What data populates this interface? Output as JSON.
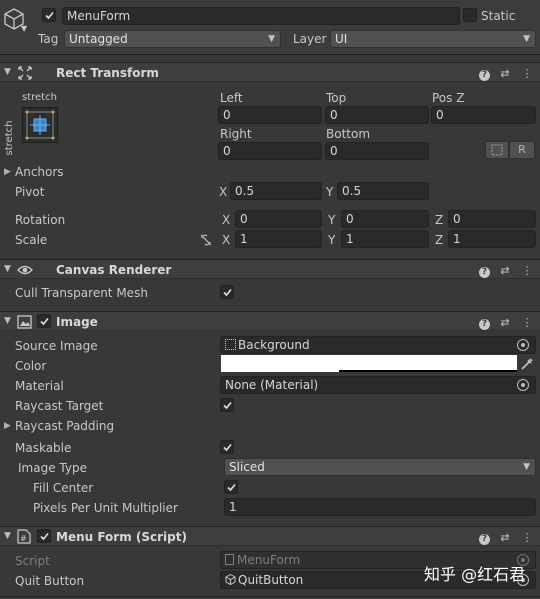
{
  "go": {
    "name": "MenuForm",
    "static_label": "Static",
    "tag_label": "Tag",
    "tag_value": "Untagged",
    "layer_label": "Layer",
    "layer_value": "UI"
  },
  "rect": {
    "title": "Rect Transform",
    "stretch_top": "stretch",
    "stretch_side": "stretch",
    "left_label": "Left",
    "left": "0",
    "top_label": "Top",
    "top": "0",
    "posz_label": "Pos Z",
    "posz": "0",
    "right_label": "Right",
    "right": "0",
    "bottom_label": "Bottom",
    "bottom": "0",
    "r_button": "R",
    "anchors": "Anchors",
    "pivot_label": "Pivot",
    "pivot_x": "0.5",
    "pivot_y": "0.5",
    "rotation_label": "Rotation",
    "rot_x": "0",
    "rot_y": "0",
    "rot_z": "0",
    "scale_label": "Scale",
    "scale_x": "1",
    "scale_y": "1",
    "scale_z": "1",
    "x": "X",
    "y": "Y",
    "z": "Z"
  },
  "canvas": {
    "title": "Canvas Renderer",
    "cull_label": "Cull Transparent Mesh"
  },
  "image": {
    "title": "Image",
    "source_label": "Source Image",
    "source_value": "Background",
    "color_label": "Color",
    "material_label": "Material",
    "material_value": "None (Material)",
    "raycast_target": "Raycast Target",
    "raycast_padding": "Raycast Padding",
    "maskable": "Maskable",
    "image_type_label": "Image Type",
    "image_type_value": "Sliced",
    "fill_center": "Fill Center",
    "ppu_label": "Pixels Per Unit Multiplier",
    "ppu_value": "1"
  },
  "script": {
    "title": "Menu Form (Script)",
    "script_label": "Script",
    "script_value": "MenuForm",
    "quit_label": "Quit Button",
    "quit_value": "QuitButton"
  },
  "watermark": "知乎 @红石君",
  "colors": {
    "bg": "#383838",
    "header": "#3e3e3e",
    "field": "#2a2a2a",
    "color_swatch": "#ffffff"
  }
}
